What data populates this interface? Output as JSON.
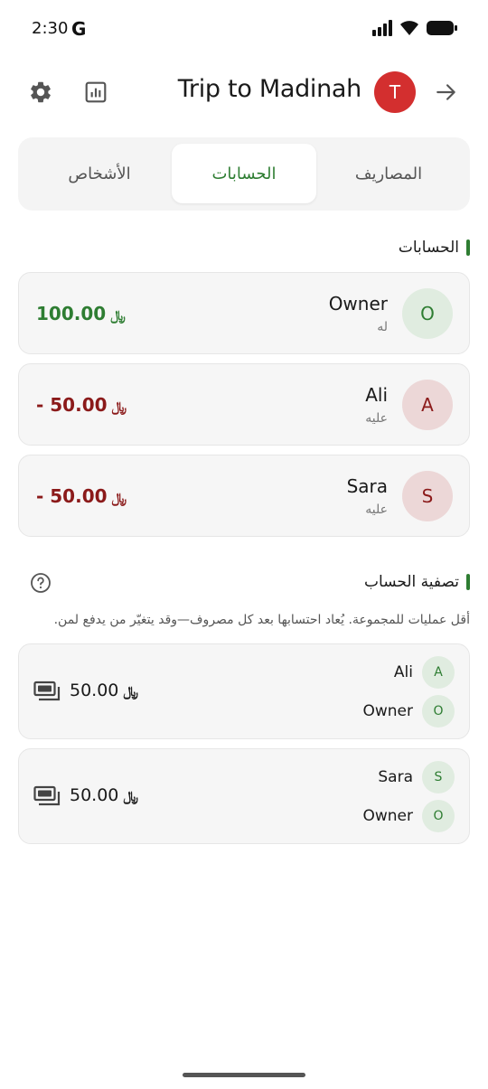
{
  "status_bar": {
    "time": "2:30",
    "g_logo": "G"
  },
  "header": {
    "title": "Trip to Madinah",
    "avatar_initial": "T",
    "avatar_color": "#d32f2f"
  },
  "tabs": [
    {
      "label": "الأشخاص",
      "active": false
    },
    {
      "label": "الحسابات",
      "active": true
    },
    {
      "label": "المصاريف",
      "active": false
    }
  ],
  "balances": {
    "title": "الحسابات",
    "items": [
      {
        "initial": "O",
        "name": "Owner",
        "status": "له",
        "amount": "100.00",
        "currency": "﷼",
        "type": "positive"
      },
      {
        "initial": "A",
        "name": "Ali",
        "status": "عليه",
        "amount": "- 50.00",
        "currency": "﷼",
        "type": "negative"
      },
      {
        "initial": "S",
        "name": "Sara",
        "status": "عليه",
        "amount": "- 50.00",
        "currency": "﷼",
        "type": "negative"
      }
    ]
  },
  "settlement": {
    "title": "تصفية الحساب",
    "description": "أقل عمليات للمجموعة. يُعاد احتسابها بعد كل مصروف—وقد يتغيّر من يدفع لمن.",
    "items": [
      {
        "from_initial": "A",
        "from_name": "Ali",
        "to_initial": "O",
        "to_name": "Owner",
        "amount": "50.00",
        "currency": "﷼"
      },
      {
        "from_initial": "S",
        "from_name": "Sara",
        "to_initial": "O",
        "to_name": "Owner",
        "amount": "50.00",
        "currency": "﷼"
      }
    ]
  },
  "colors": {
    "accent": "#2e7d32",
    "negative": "#8b1a1a"
  },
  "icons": [
    "settings-icon",
    "chart-icon",
    "arrow-forward-icon",
    "help-icon",
    "cash-icon"
  ]
}
